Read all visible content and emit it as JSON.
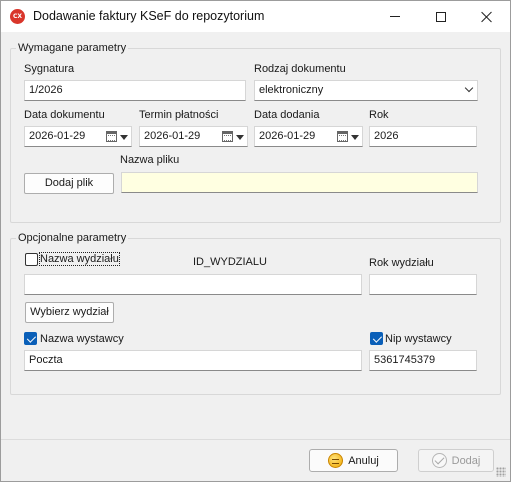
{
  "window": {
    "icon_text": "CX",
    "title": "Dodawanie faktury KSeF do repozytorium"
  },
  "required": {
    "group_title": "Wymagane parametry",
    "signature_label": "Sygnatura",
    "signature_value": "1/2026",
    "doc_type_label": "Rodzaj dokumentu",
    "doc_type_value": "elektroniczny",
    "doc_date_label": "Data dokumentu",
    "doc_date_value": "2026-01-29",
    "due_date_label": "Termin płatności",
    "due_date_value": "2026-01-29",
    "added_date_label": "Data dodania",
    "added_date_value": "2026-01-29",
    "year_label": "Rok",
    "year_value": "2026",
    "filename_label": "Nazwa pliku",
    "filename_value": "",
    "add_file_button": "Dodaj plik"
  },
  "optional": {
    "group_title": "Opcjonalne parametry",
    "dept_name_label": "Nazwa wydziału",
    "dept_name_checked": false,
    "dept_id_label": "ID_WYDZIALU",
    "dept_year_label": "Rok wydziału",
    "dept_name_value": "",
    "dept_year_value": "",
    "choose_dept_button": "Wybierz wydział",
    "issuer_name_label": "Nazwa wystawcy",
    "issuer_name_checked": true,
    "issuer_name_value": "Poczta",
    "issuer_nip_label": "Nip wystawcy",
    "issuer_nip_checked": true,
    "issuer_nip_value": "5361745379"
  },
  "footer": {
    "cancel_label": "Anuluj",
    "add_label": "Dodaj",
    "add_enabled": false
  },
  "colors": {
    "accent": "#0a5fb8",
    "filename_background": "#ffffe1",
    "app_icon": "#d9362b"
  }
}
